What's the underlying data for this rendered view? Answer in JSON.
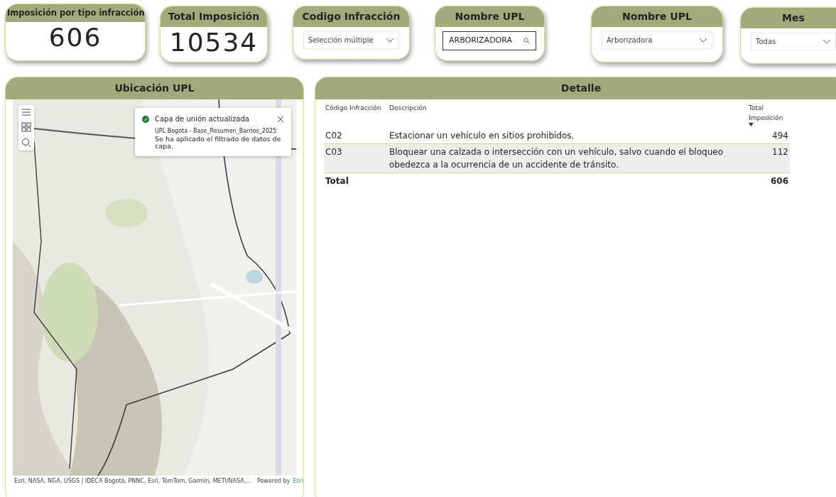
{
  "cards": [
    {
      "kind": "kpi",
      "title": "Imposición por tipo infracción",
      "value": "606"
    },
    {
      "kind": "kpi",
      "title": "Total Imposición",
      "value": "10534"
    },
    {
      "kind": "dropdown",
      "title": "Codigo Infracción",
      "value": "Selección múltiple"
    },
    {
      "kind": "search",
      "title": "Nombre UPL",
      "value": "ARBORIZADORA"
    },
    {
      "kind": "dropdown",
      "title": "Nombre UPL",
      "value": "Arborizadora"
    },
    {
      "kind": "dropdown",
      "title": "Mes",
      "value": "Todas"
    }
  ],
  "map_panel": {
    "title": "Ubicación UPL",
    "notification": {
      "title": "Capa de unión actualizada",
      "layer": "UPL Bogota - Base_Resumen_Barrios_2025",
      "message": "Se ha aplicado el filtrado de datos de capa."
    },
    "attribution": "Esri, NASA, NGA, USGS | IDECA Bogotá, PNNC, Esri, TomTom, Garmin, METI/NASA,...",
    "powered_by": "Powered by",
    "powered_link": "Esri"
  },
  "detail": {
    "title": "Detalle",
    "columns": [
      "Código Infracción",
      "Descripción",
      "Total Imposición"
    ],
    "rows": [
      {
        "code": "C02",
        "description": "Estacionar un vehículo en sitios prohibidos.",
        "total": "494",
        "selected": false
      },
      {
        "code": "C03",
        "description": "Bloquear una calzada o intersección con un vehículo, salvo cuando el bloqueo obedezca a la ocurrencia de un accidente de tránsito.",
        "total": "112",
        "selected": true
      }
    ],
    "total_label": "Total",
    "total_value": "606"
  }
}
